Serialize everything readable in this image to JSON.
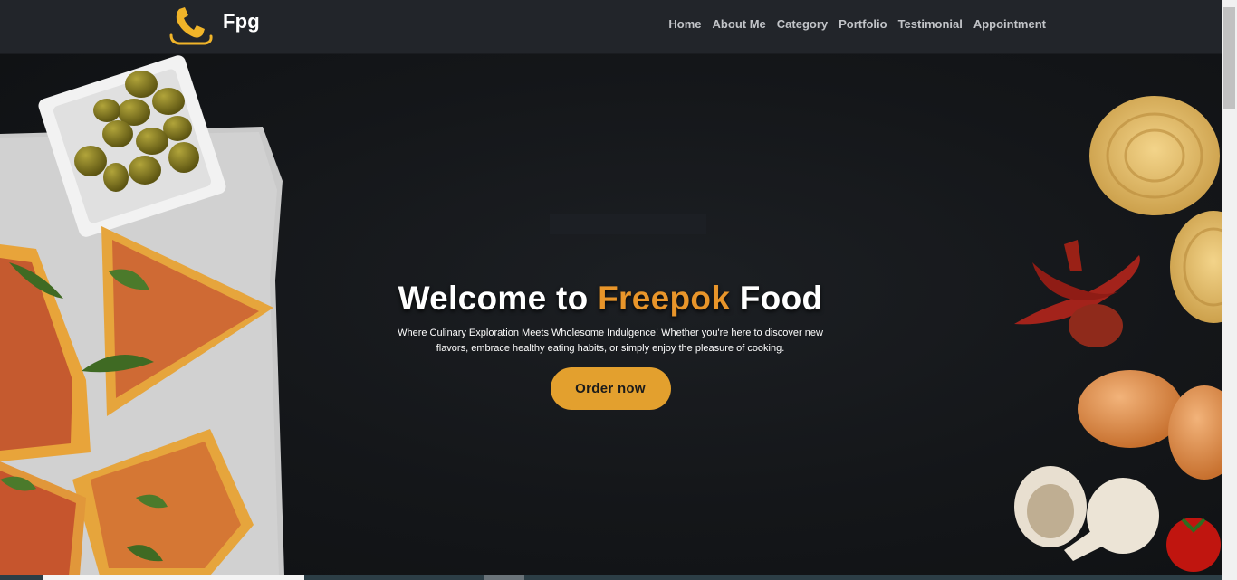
{
  "brand": {
    "name": "Fpg",
    "icon": "phone-icon",
    "icon_color": "#f0b429"
  },
  "nav": {
    "items": [
      "Home",
      "About Me",
      "Category",
      "Portfolio",
      "Testimonial",
      "Appointment"
    ]
  },
  "hero": {
    "title_part1": "Welcome to ",
    "title_accent": "Freepok",
    "title_part2": " Food",
    "description": "Where Culinary Exploration Meets Wholesome Indulgence! Whether you're here to discover new flavors, embrace healthy eating habits, or simply enjoy the pleasure of cooking.",
    "cta_label": "Order now",
    "accent_color": "#e8952a",
    "cta_color": "#e3a02e"
  }
}
